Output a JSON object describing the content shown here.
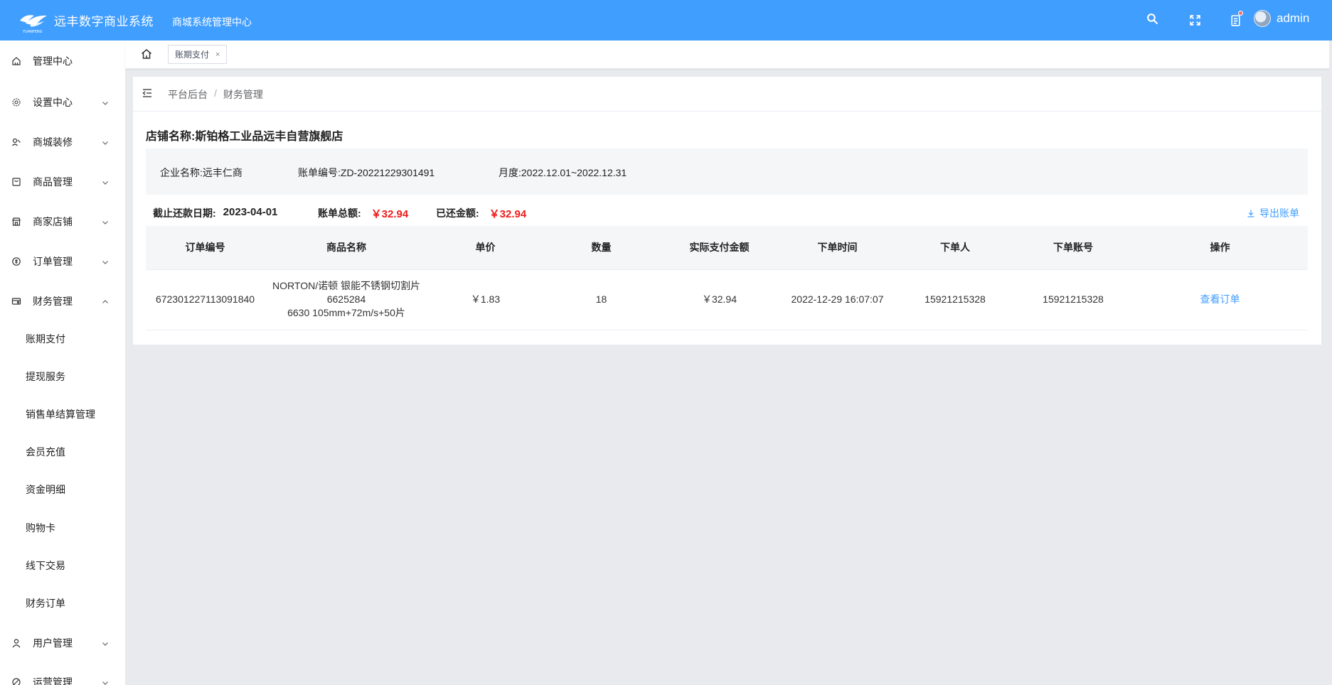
{
  "header": {
    "logo_text": "YUANFENG",
    "app_title": "远丰数字商业系统",
    "subtitle": "商城系统管理中心",
    "username": "admin",
    "icons": [
      "search-icon",
      "fullscreen-icon",
      "message-icon"
    ],
    "brand_color": "#409eff"
  },
  "sidebar": {
    "items": [
      {
        "label": "管理中心",
        "icon": "home-icon"
      },
      {
        "label": "设置中心",
        "icon": "gear-icon"
      },
      {
        "label": "商城装修",
        "icon": "decorate-icon"
      },
      {
        "label": "商品管理",
        "icon": "goods-icon"
      },
      {
        "label": "商家店铺",
        "icon": "store-icon"
      },
      {
        "label": "订单管理",
        "icon": "order-icon"
      },
      {
        "label": "财务管理",
        "icon": "finance-icon"
      },
      {
        "label": "用户管理",
        "icon": "user-icon"
      },
      {
        "label": "运营管理",
        "icon": "operation-icon"
      }
    ],
    "finance_sub": [
      "账期支付",
      "提现服务",
      "销售单结算管理",
      "会员充值",
      "资金明细",
      "购物卡",
      "线下交易",
      "财务订单"
    ]
  },
  "tabs": [
    {
      "label": "账期支付",
      "close": "×"
    }
  ],
  "breadcrumb": [
    "平台后台",
    "/",
    "财务管理"
  ],
  "shop": {
    "label": "店铺名称:",
    "name": "斯铂格工业品远丰自营旗舰店"
  },
  "info": {
    "company": "企业名称:远丰仁商",
    "bill_no": "账单编号:ZD-20221229301491",
    "month": "月度:2022.12.01~2022.12.31"
  },
  "summary": {
    "due_label": "截止还款日期:",
    "due_value": "2023-04-01",
    "total_label": "账单总额:",
    "total_value": "￥32.94",
    "paid_label": "已还金额:",
    "paid_value": "￥32.94",
    "export_label": "导出账单"
  },
  "table": {
    "headers": [
      "订单编号",
      "商品名称",
      "单价",
      "数量",
      "实际支付金额",
      "下单时间",
      "下单人",
      "下单账号",
      "操作"
    ],
    "rows": [
      {
        "order_no": "672301227113091840",
        "goods_line1": "NORTON/诺顿 银能不锈钢切割片 6625284",
        "goods_line2": "6630 105mm+72m/s+50片",
        "price": "￥1.83",
        "qty": "18",
        "paid": "￥32.94",
        "time": "2022-12-29 16:07:07",
        "buyer": "15921215328",
        "account": "15921215328",
        "action": "查看订单"
      }
    ]
  },
  "colors": {
    "accent": "#409eff",
    "amount_red": "#f01a1a",
    "page_bg": "#e8eaee"
  }
}
